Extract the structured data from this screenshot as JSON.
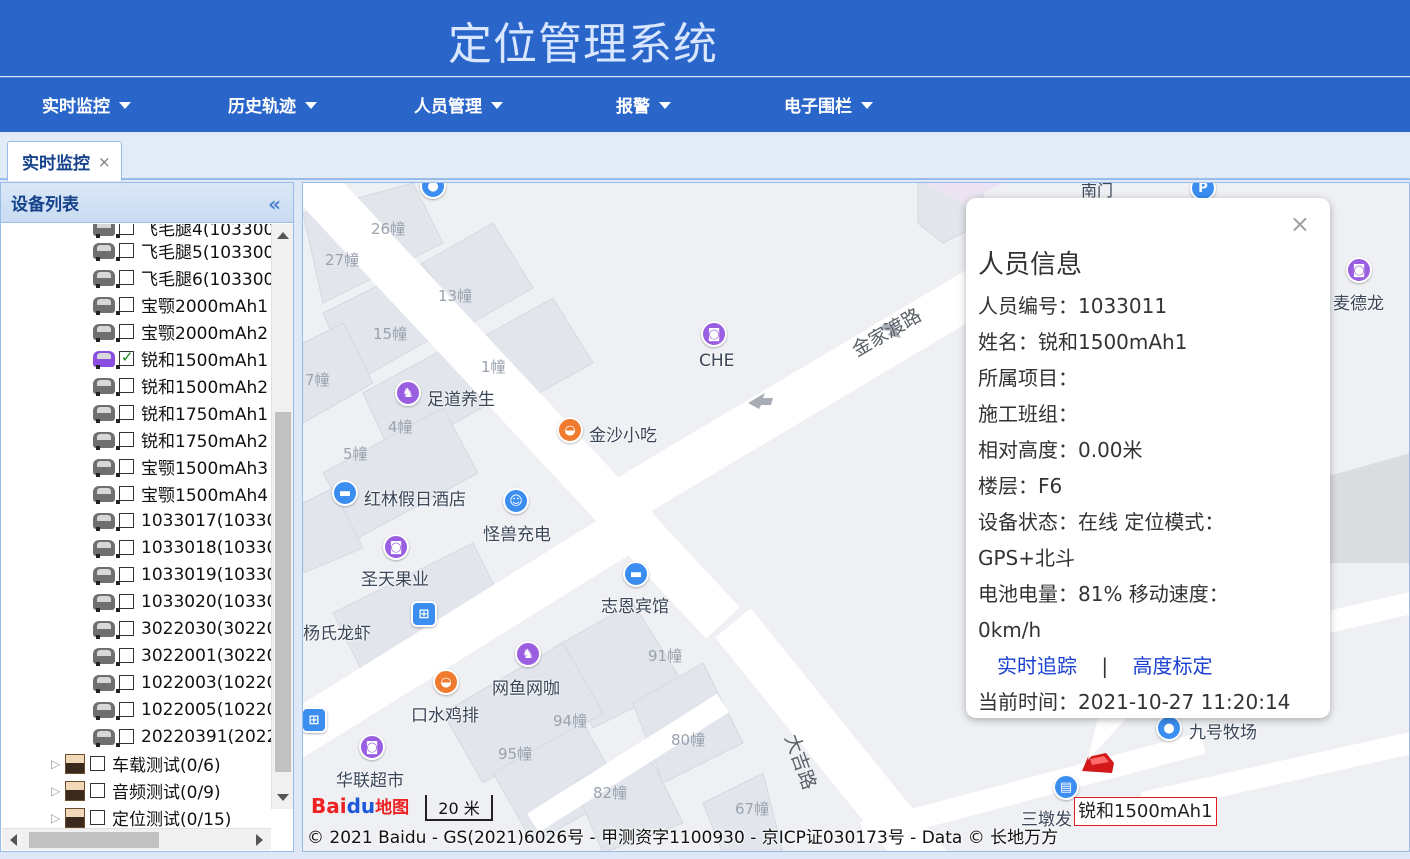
{
  "app": {
    "title": "定位管理系统"
  },
  "nav": {
    "items": [
      {
        "label": "实时监控"
      },
      {
        "label": "历史轨迹"
      },
      {
        "label": "人员管理"
      },
      {
        "label": "报警"
      },
      {
        "label": "电子围栏"
      }
    ]
  },
  "tabs": [
    {
      "label": "实时监控",
      "close": "×"
    }
  ],
  "sidebar": {
    "title": "设备列表",
    "collapse_icon": "«",
    "devices": [
      {
        "label": "飞毛腿4(103300",
        "checked": false
      },
      {
        "label": "飞毛腿5(103300",
        "checked": false
      },
      {
        "label": "飞毛腿6(103300",
        "checked": false
      },
      {
        "label": "宝颚2000mAh1",
        "checked": false
      },
      {
        "label": "宝颚2000mAh2",
        "checked": false
      },
      {
        "label": "锐和1500mAh1",
        "checked": true
      },
      {
        "label": "锐和1500mAh2",
        "checked": false
      },
      {
        "label": "锐和1750mAh1",
        "checked": false
      },
      {
        "label": "锐和1750mAh2",
        "checked": false
      },
      {
        "label": "宝颚1500mAh3",
        "checked": false
      },
      {
        "label": "宝颚1500mAh4",
        "checked": false
      },
      {
        "label": "1033017(10330",
        "checked": false
      },
      {
        "label": "1033018(10330",
        "checked": false
      },
      {
        "label": "1033019(10330",
        "checked": false
      },
      {
        "label": "1033020(10330",
        "checked": false
      },
      {
        "label": "3022030(30220",
        "checked": false
      },
      {
        "label": "3022001(30220",
        "checked": false
      },
      {
        "label": "1022003(10220",
        "checked": false
      },
      {
        "label": "1022005(10220",
        "checked": false
      },
      {
        "label": "20220391(2022",
        "checked": false
      }
    ],
    "groups": [
      {
        "label": "车载测试(0/6)"
      },
      {
        "label": "音频测试(0/9)"
      },
      {
        "label": "定位测试(0/15)"
      }
    ]
  },
  "map": {
    "buildings": [
      "26幢",
      "27幢",
      "13幢",
      "15幢",
      "1幢",
      "7幢",
      "4幢",
      "5幢",
      "91幢",
      "94幢",
      "95幢",
      "80幢",
      "82幢",
      "67幢"
    ],
    "roads": [
      "金家渡路",
      "大吉路",
      "南门"
    ],
    "pois": [
      {
        "label": "CHE"
      },
      {
        "label": "足道养生"
      },
      {
        "label": "金沙小吃"
      },
      {
        "label": "红林假日酒店"
      },
      {
        "label": "怪兽充电"
      },
      {
        "label": "圣天果业"
      },
      {
        "label": "志恩宾馆"
      },
      {
        "label": "杨氏龙虾"
      },
      {
        "label": "网鱼网咖"
      },
      {
        "label": "口水鸡排"
      },
      {
        "label": "华联超市"
      },
      {
        "label": "麦德龙"
      },
      {
        "label": "九号牧场"
      },
      {
        "label": "三墩发"
      }
    ],
    "device_label": "锐和1500mAh1",
    "scale": "20 米",
    "logo": {
      "bai": "Bai",
      "du": "du",
      "map": "地图"
    },
    "copyright": "© 2021 Baidu - GS(2021)6026号 - 甲测资字1100930 - 京ICP证030173号 - Data © 长地万方"
  },
  "popup": {
    "title": "人员信息",
    "close": "×",
    "lines": [
      "人员编号：1033011",
      "姓名：锐和1500mAh1",
      "所属项目：",
      "施工班组：",
      "相对高度：0.00米",
      "楼层：F6",
      "设备状态：在线 定位模式：",
      "GPS+北斗",
      "电池电量：81% 移动速度：",
      "0km/h"
    ],
    "link_track": "实时追踪",
    "link_sep": "|",
    "link_height": "高度标定",
    "time": "当前时间：2021-10-27 11:20:14"
  }
}
